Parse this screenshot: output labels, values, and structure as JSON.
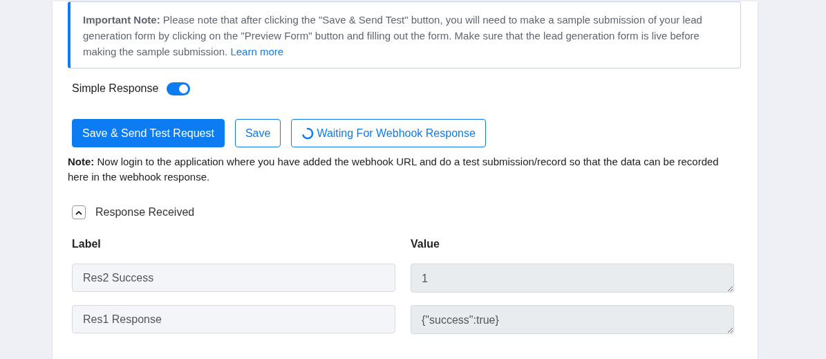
{
  "note": {
    "text": "**Important Note:** Please note that after clicking the \"Save & Send Test\" button, you will need to make a sample submission of your lead generation form by clicking on the \"Preview Form\" button and filling out the form. Make sure that the lead generation form is live before making the sample submission.",
    "link": "Learn more"
  },
  "simple_response": {
    "label": "Simple Response",
    "on": true
  },
  "buttons": [
    {
      "label": "Save & Send Test Request",
      "kind": "primary"
    },
    {
      "label": "Save",
      "kind": "outline"
    },
    {
      "label": "Waiting For Webhook Response",
      "kind": "loading"
    }
  ],
  "help_note": "**Note:** Now login to the application where you have added the webhook URL and do a test submission/record so that the data can be recorded here in the webhook response.",
  "response_section": {
    "title": "Response Received",
    "expanded": true,
    "columns": [
      "Label",
      "Value"
    ],
    "rows": [
      {
        "label": "Res2 Success",
        "value": "1"
      },
      {
        "label": "Res1 Response",
        "value": "{\"success\":true}"
      }
    ]
  }
}
